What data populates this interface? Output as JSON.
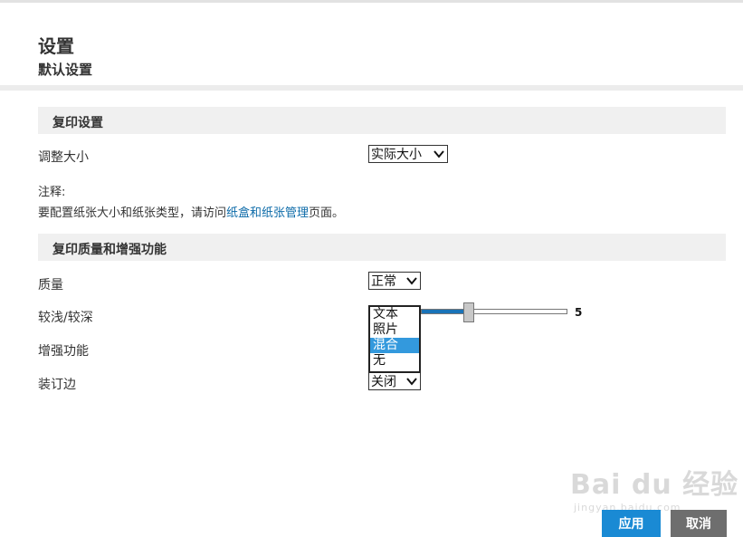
{
  "header": {
    "title": "设置",
    "subtitle": "默认设置"
  },
  "copy_settings": {
    "section_title": "复印设置",
    "resize_label": "调整大小",
    "resize_value": "实际大小",
    "note_label": "注释:",
    "note_prefix": "要配置纸张大小和纸张类型，请访问",
    "note_link": "纸盒和纸张管理",
    "note_suffix": "页面。"
  },
  "quality_section": {
    "section_title": "复印质量和增强功能",
    "quality_label": "质量",
    "quality_value": "正常",
    "lighter_darker_label": "较浅/较深",
    "lighter_darker_value": "5",
    "lighter_darker_level": 5,
    "enhance_label": "增强功能",
    "enhance_options": [
      "文本",
      "照片",
      "混合",
      "无"
    ],
    "enhance_selected": "混合",
    "binding_label": "装订边",
    "binding_value": "关闭"
  },
  "watermark": {
    "main": "Bai du 经验",
    "sub": "jingyan.baidu.com"
  },
  "buttons": {
    "apply": "应用",
    "cancel": "取消"
  },
  "colors": {
    "accent": "#1a8ad4",
    "slider_fill": "#1a73b8",
    "selected_option": "#3399dd",
    "cancel_bg": "#6e6e6e",
    "link": "#0b6aa8"
  }
}
